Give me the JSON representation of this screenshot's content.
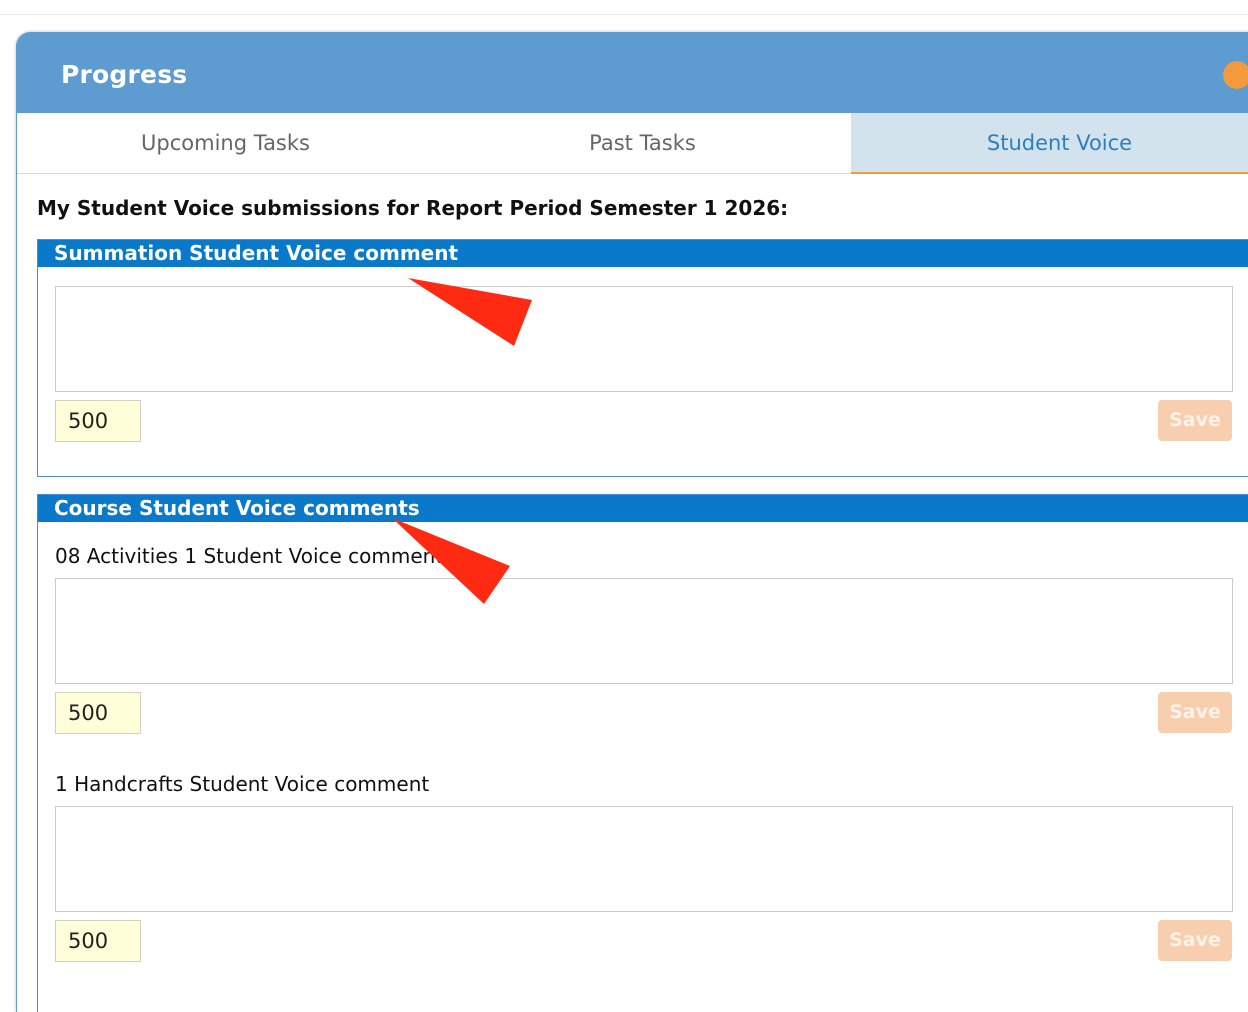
{
  "panel": {
    "title": "Progress"
  },
  "tabs": [
    {
      "label": "Upcoming Tasks"
    },
    {
      "label": "Past Tasks"
    },
    {
      "label": "Student Voice"
    }
  ],
  "heading": "My Student Voice submissions for Report Period Semester 1 2026:",
  "summation": {
    "title": "Summation Student Voice comment",
    "counter": "500",
    "save_label": "Save"
  },
  "course": {
    "title": "Course Student Voice comments",
    "items": [
      {
        "label": "08 Activities 1 Student Voice comment",
        "counter": "500",
        "save_label": "Save"
      },
      {
        "label": "1 Handcrafts Student Voice comment",
        "counter": "500",
        "save_label": "Save"
      }
    ]
  },
  "colors": {
    "header": "#5e9bd1",
    "section_header": "#0a79c9",
    "accent": "#f29a3c",
    "active_tab_bg": "#d2e3ee",
    "annotation_arrow": "#ff2a12"
  }
}
